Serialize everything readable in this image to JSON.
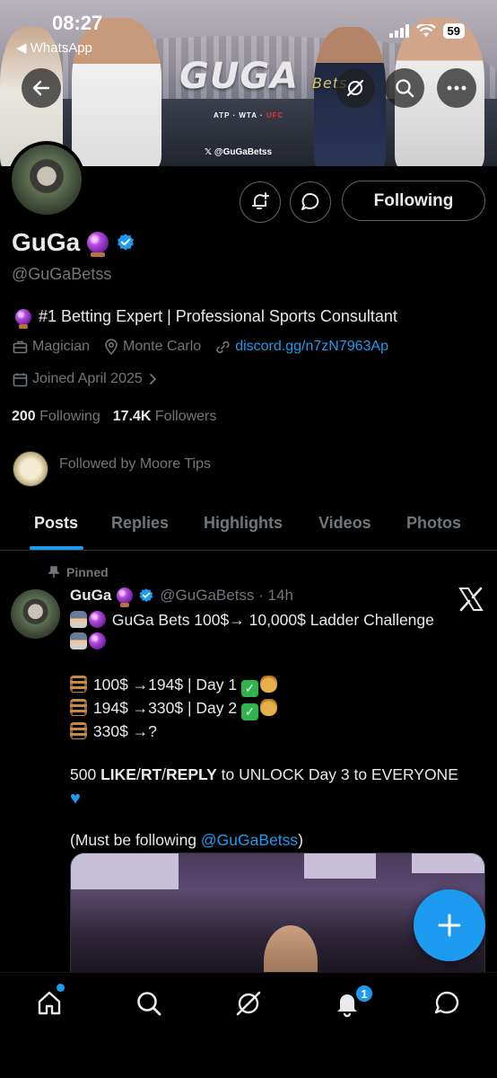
{
  "status_bar": {
    "time": "08:27",
    "back_app": "◀ WhatsApp",
    "battery": "59"
  },
  "banner": {
    "logo": "GUGA",
    "logo_script": "Bets",
    "sponsors": [
      "ATP",
      "WTA",
      "UFC"
    ],
    "handle": "𝕏 @GuGaBetss"
  },
  "profile": {
    "name": "GuGa",
    "handle": "@GuGaBetss",
    "bio": "#1 Betting Expert | Professional Sports Consultant",
    "category": "Magician",
    "location": "Monte Carlo",
    "link": "discord.gg/n7zN7963Ap",
    "joined": "Joined April 2025",
    "following_count": "200",
    "following_label": "Following",
    "followers_count": "17.4K",
    "followers_label": "Followers",
    "followed_by": "Followed by Moore Tips",
    "follow_button": "Following"
  },
  "tabs": [
    "Posts",
    "Replies",
    "Highlights",
    "Videos",
    "Photos"
  ],
  "post": {
    "pinned_label": "Pinned",
    "name": "GuGa",
    "handle_time": "@GuGaBetss · 14h",
    "lines": [
      "GuGa Bets 100$→ 10,000$ Ladder Challenge",
      "100$ →194$ | Day 1",
      "194$ →330$ | Day 2",
      "330$ →?",
      "500",
      "LIKE",
      "/",
      "RT",
      "/",
      "REPLY",
      " to UNLOCK Day 3 to EVERYONE",
      "(Must be following ",
      "@GuGaBetss",
      ")"
    ]
  },
  "colors": {
    "accent": "#1d9bf0",
    "background": "#000000",
    "muted": "#71767b"
  },
  "icons": [
    "back-arrow-icon",
    "grok-icon",
    "search-icon",
    "more-icon",
    "notification-add-icon",
    "message-icon",
    "verified-icon",
    "briefcase-icon",
    "location-icon",
    "link-icon",
    "calendar-icon",
    "chevron-right-icon",
    "pin-icon",
    "x-logo-icon",
    "plus-icon",
    "home-icon",
    "grok-nav-icon",
    "bell-icon",
    "mail-icon"
  ],
  "nav": {
    "notifications_badge": "1"
  }
}
